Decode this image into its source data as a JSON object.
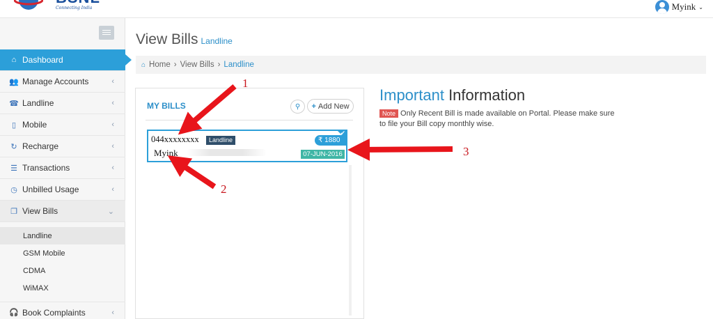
{
  "header": {
    "brand": "BSNL",
    "tagline": "Connecting India",
    "user_name": "Myink"
  },
  "sidebar": {
    "items": [
      {
        "label": "Dashboard",
        "icon": "home-icon"
      },
      {
        "label": "Manage Accounts",
        "icon": "users-icon"
      },
      {
        "label": "Landline",
        "icon": "phone-icon"
      },
      {
        "label": "Mobile",
        "icon": "mobile-icon"
      },
      {
        "label": "Recharge",
        "icon": "refresh-icon"
      },
      {
        "label": "Transactions",
        "icon": "list-icon"
      },
      {
        "label": "Unbilled Usage",
        "icon": "clock-icon"
      },
      {
        "label": "View Bills",
        "icon": "copy-icon"
      },
      {
        "label": "Book Complaints",
        "icon": "headset-icon"
      }
    ],
    "sub_items": [
      "Landline",
      "GSM Mobile",
      "CDMA",
      "WiMAX"
    ]
  },
  "page": {
    "title": "View Bills",
    "subtitle": "Landline"
  },
  "breadcrumb": {
    "home": "Home",
    "section": "View Bills",
    "current": "Landline"
  },
  "bills_panel": {
    "heading": "MY BILLS",
    "add_label": "Add New",
    "bill": {
      "number": "044xxxxxxxx",
      "type": "Landline",
      "name": "Myink",
      "amount": "₹ 1880",
      "date": "07-JUN-2016"
    }
  },
  "info": {
    "title_highlight": "Important",
    "title_rest": "Information",
    "note_label": "Note",
    "note_text": "Only Recent Bill is made available on Portal. Please make sure to file your Bill copy monthly wise."
  },
  "annotations": {
    "labels": [
      "1",
      "2",
      "3"
    ],
    "arrow_color": "#e8151b"
  },
  "colors": {
    "accent": "#2c9fd9",
    "tag_dark": "#2f4e6a",
    "date_badge": "#3fb6a6",
    "note_red": "#e05552"
  }
}
